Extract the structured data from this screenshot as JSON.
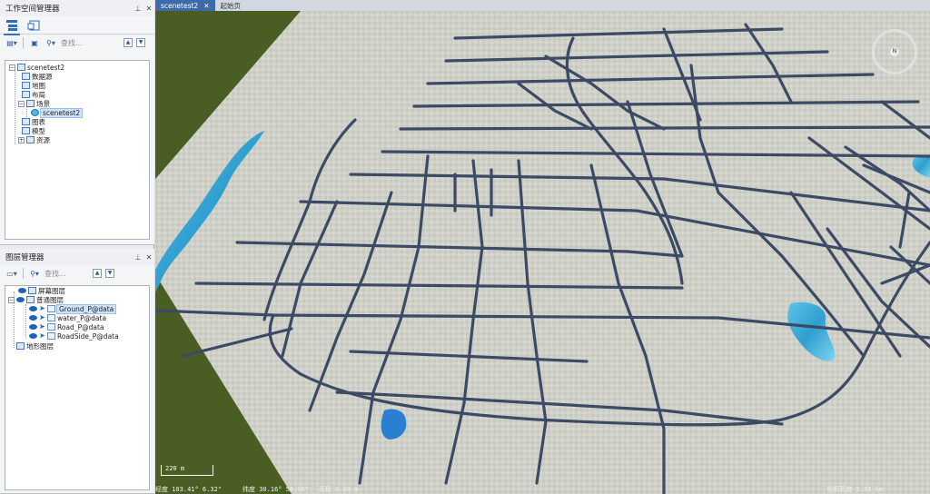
{
  "workspace_panel": {
    "title": "工作空间管理器",
    "pin": "📌",
    "close": "✕",
    "search_placeholder": "查找...",
    "tree": [
      {
        "label": "scenetest2"
      },
      {
        "label": "数据源"
      },
      {
        "label": "地图"
      },
      {
        "label": "布局"
      },
      {
        "label": "场景"
      },
      {
        "label": "scenetest2"
      },
      {
        "label": "图表"
      },
      {
        "label": "模型"
      },
      {
        "label": "资源"
      }
    ]
  },
  "layer_panel": {
    "title": "图层管理器",
    "pin": "📌",
    "close": "✕",
    "search_placeholder": "查找...",
    "tree": [
      {
        "label": "屏幕图层"
      },
      {
        "label": "普通图层"
      },
      {
        "label": "Ground_P@data"
      },
      {
        "label": "water_P@data"
      },
      {
        "label": "Road_P@data"
      },
      {
        "label": "RoadSide_P@data"
      },
      {
        "label": "地形图层"
      }
    ]
  },
  "document_tabs": [
    {
      "label": "scenetest2",
      "close": "✕",
      "active": true
    },
    {
      "label": "起始页",
      "active": false
    }
  ],
  "scene": {
    "compass_label": "N",
    "scale_label": "220 m",
    "status": {
      "lon": "经度 103.41° 6.32\"",
      "lat": "纬度 30.16° 58.08\"",
      "alt": "高程 0.00 m",
      "cam": "相机高度 2.33 km"
    }
  }
}
